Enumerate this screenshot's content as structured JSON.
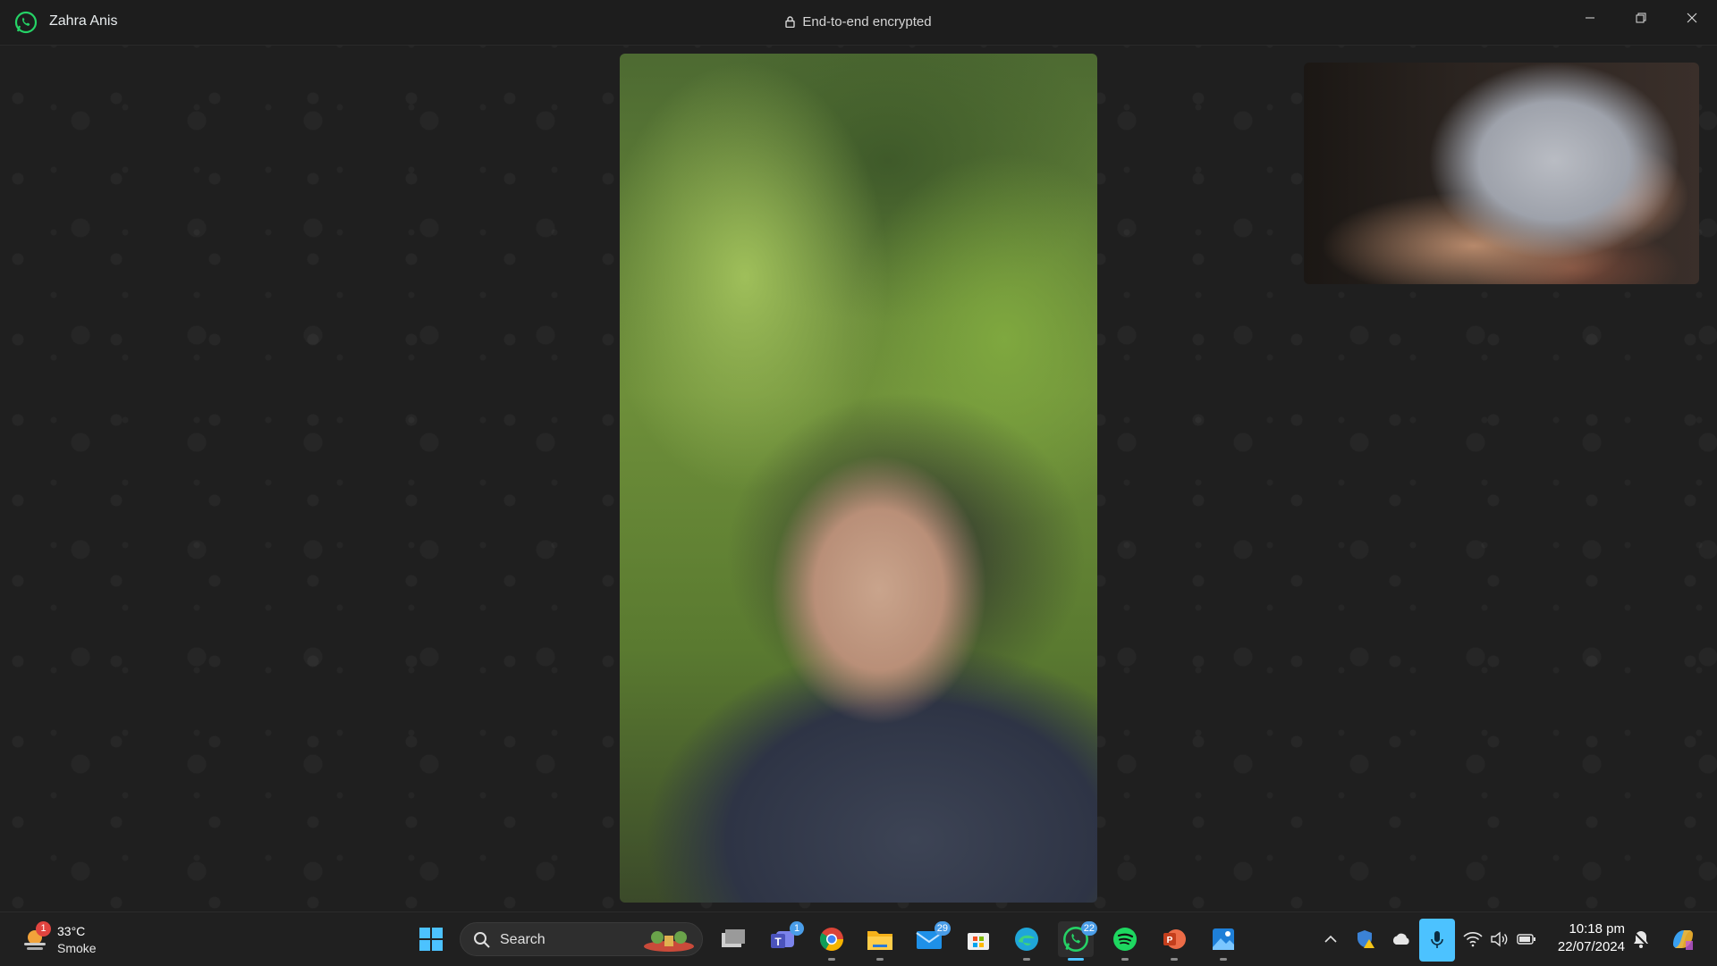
{
  "window": {
    "contact_name": "Zahra Anis",
    "encryption_text": "End-to-end encrypted"
  },
  "taskbar": {
    "weather": {
      "badge": "1",
      "temperature": "33°C",
      "condition": "Smoke"
    },
    "search": {
      "placeholder": "Search"
    },
    "apps": [
      {
        "name": "start",
        "badge": ""
      },
      {
        "name": "task-view",
        "badge": ""
      },
      {
        "name": "teams",
        "badge": "1"
      },
      {
        "name": "chrome",
        "badge": ""
      },
      {
        "name": "file-explorer",
        "badge": ""
      },
      {
        "name": "mail",
        "badge": "29"
      },
      {
        "name": "microsoft-store",
        "badge": ""
      },
      {
        "name": "edge",
        "badge": ""
      },
      {
        "name": "whatsapp",
        "badge": "22"
      },
      {
        "name": "spotify",
        "badge": ""
      },
      {
        "name": "powerpoint",
        "badge": ""
      },
      {
        "name": "photos",
        "badge": ""
      }
    ],
    "clock": {
      "time": "10:18 pm",
      "date": "22/07/2024"
    }
  },
  "colors": {
    "whatsapp_green": "#25d366",
    "accent_blue": "#4cc2ff",
    "badge_red": "#e0443f"
  }
}
